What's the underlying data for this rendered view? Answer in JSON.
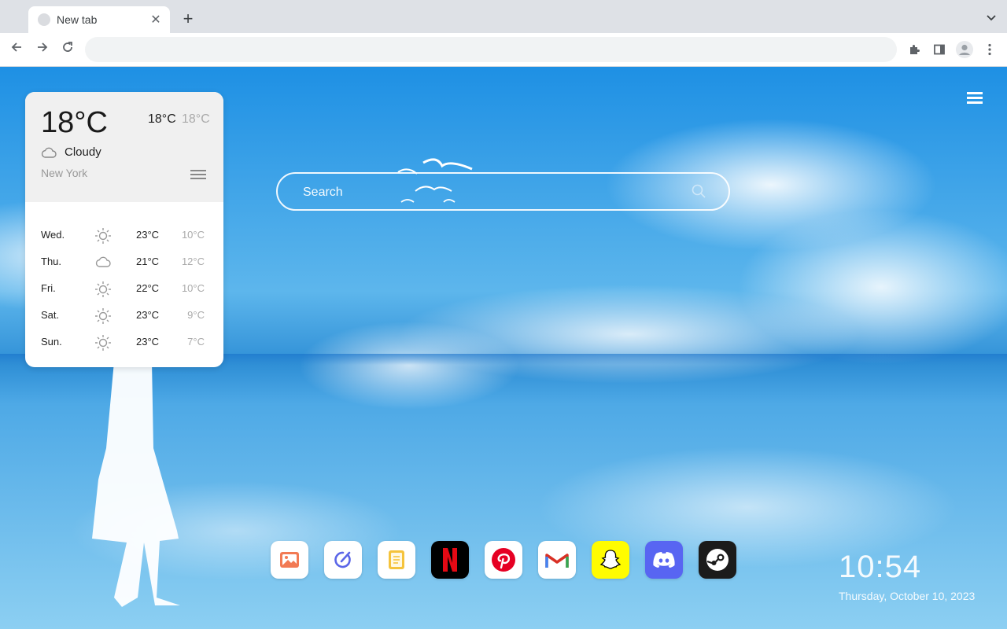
{
  "browser": {
    "tab": {
      "title": "New tab"
    },
    "omnibox": {
      "value": "",
      "placeholder": ""
    }
  },
  "weather": {
    "temp": "18°C",
    "high": "18°C",
    "low": "18°C",
    "condition": "Cloudy",
    "city": "New York",
    "forecast": [
      {
        "day": "Wed.",
        "icon": "sun-icon",
        "high": "23°C",
        "low": "10°C"
      },
      {
        "day": "Thu.",
        "icon": "cloud-icon",
        "high": "21°C",
        "low": "12°C"
      },
      {
        "day": "Fri.",
        "icon": "sun-icon",
        "high": "22°C",
        "low": "10°C"
      },
      {
        "day": "Sat.",
        "icon": "sun-icon",
        "high": "23°C",
        "low": "9°C"
      },
      {
        "day": "Sun.",
        "icon": "sun-icon",
        "high": "23°C",
        "low": "7°C"
      }
    ]
  },
  "search": {
    "placeholder": "Search"
  },
  "apps": [
    {
      "name": "photos",
      "icon": "photos-icon",
      "color": "#ffffff"
    },
    {
      "name": "edit",
      "icon": "edit-icon",
      "color": "#ffffff"
    },
    {
      "name": "notes",
      "icon": "notes-icon",
      "color": "#ffffff"
    },
    {
      "name": "netflix",
      "icon": "netflix-icon",
      "color": "#000000"
    },
    {
      "name": "pinterest",
      "icon": "pinterest-icon",
      "color": "#ffffff"
    },
    {
      "name": "gmail",
      "icon": "gmail-icon",
      "color": "#ffffff"
    },
    {
      "name": "snapchat",
      "icon": "snapchat-icon",
      "color": "#fffc00"
    },
    {
      "name": "discord",
      "icon": "discord-icon",
      "color": "#5865f2"
    },
    {
      "name": "steam",
      "icon": "steam-icon",
      "color": "#1b1b1b"
    }
  ],
  "clock": {
    "time": "10:54",
    "date": "Thursday, October 10, 2023"
  }
}
